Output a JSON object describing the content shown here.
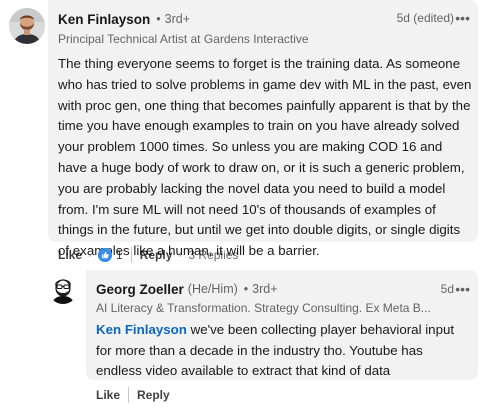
{
  "comment": {
    "author": "Ken Finlayson",
    "degree": "3rd+",
    "headline": "Principal Technical Artist at Gardens Interactive",
    "time": "5d (edited)",
    "more": "•••",
    "text": "The thing everyone seems to forget is the training data. As someone who has tried to solve problems in game dev with ML in the past, even with proc gen, one thing that becomes painfully apparent is that by the time you have enough examples to train on you have already solved your problem 1000 times. So unless you are making COD 16 and have a huge body of work to draw on, or it is such a generic problem, you are probably lacking the novel data you need to build a model from. I'm sure ML will not need 10's of thousands of examples of things in the future, but until we get into double digits, or single digits of examples like a human, it will be a barrier.",
    "actions": {
      "like": "Like",
      "reaction_count": "1",
      "reaction_icon": "thumbs-up-icon",
      "reply": "Reply",
      "replies": "3 Replies"
    }
  },
  "reply": {
    "author": "Georg Zoeller",
    "pronouns": "(He/Him)",
    "degree": "3rd+",
    "headline": "AI Literacy & Transformation. Strategy Consulting. Ex Meta B...",
    "time": "5d",
    "more": "•••",
    "mention": "Ken Finlayson",
    "text": " we've been collecting player behavioral input for more than a decade in the industry tho. Youtube has endless video available to extract that kind of data",
    "actions": {
      "like": "Like",
      "reply": "Reply"
    }
  },
  "colors": {
    "bubble": "#f2f2f2",
    "link": "#0a66c2",
    "reaction": "#378fe9"
  }
}
